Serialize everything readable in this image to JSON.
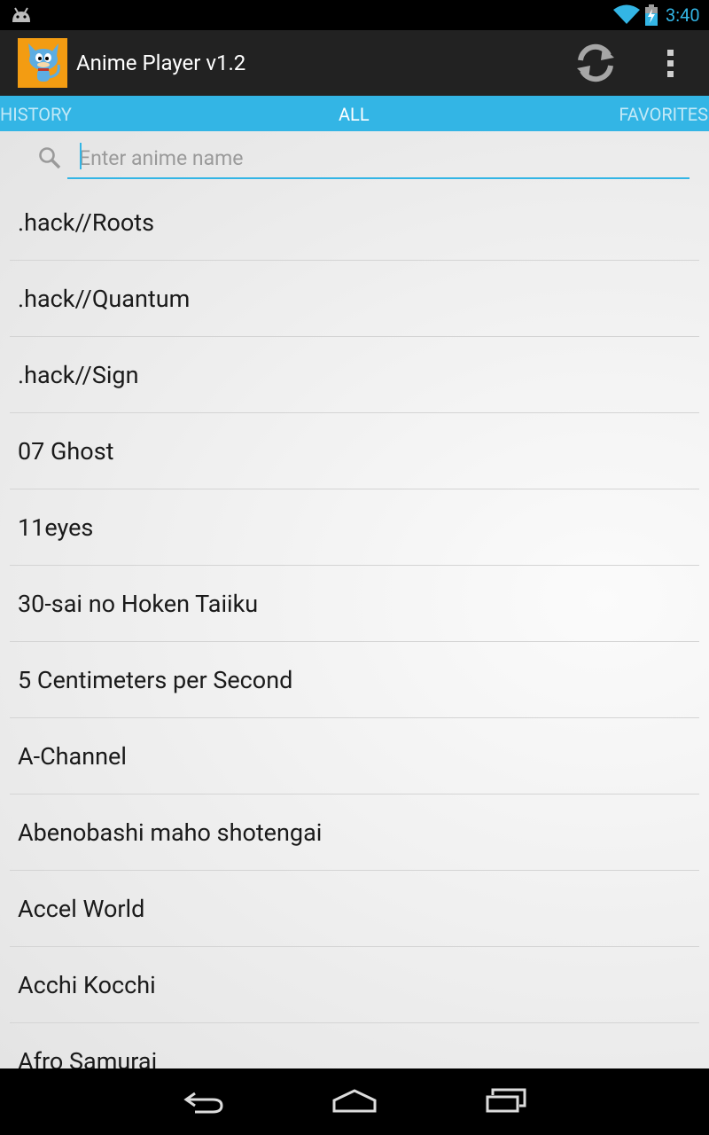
{
  "status_bar": {
    "time": "3:40",
    "icons": [
      "android-notification-icon",
      "wifi-icon",
      "battery-charging-icon"
    ]
  },
  "action_bar": {
    "title": "Anime Player v1.2",
    "icons": [
      "app-icon",
      "refresh-icon",
      "overflow-menu-icon"
    ]
  },
  "tabs": [
    {
      "label": "HISTORY",
      "selected": false
    },
    {
      "label": "ALL",
      "selected": true
    },
    {
      "label": "FAVORITES",
      "selected": false
    }
  ],
  "search": {
    "placeholder": "Enter anime name",
    "value": ""
  },
  "anime_list": [
    ".hack//Roots",
    ".hack//Quantum",
    ".hack//Sign",
    "07 Ghost",
    "11eyes",
    "30-sai no Hoken Taiiku",
    "5 Centimeters per Second",
    "A-Channel",
    "Abenobashi maho shotengai",
    "Accel World",
    "Acchi Kocchi",
    "Afro Samurai"
  ],
  "nav_bar": {
    "icons": [
      "back-icon",
      "home-icon",
      "recents-icon"
    ]
  },
  "colors": {
    "accent": "#33b5e5",
    "action_bar": "#222222",
    "app_icon_bg": "#f39c12"
  }
}
